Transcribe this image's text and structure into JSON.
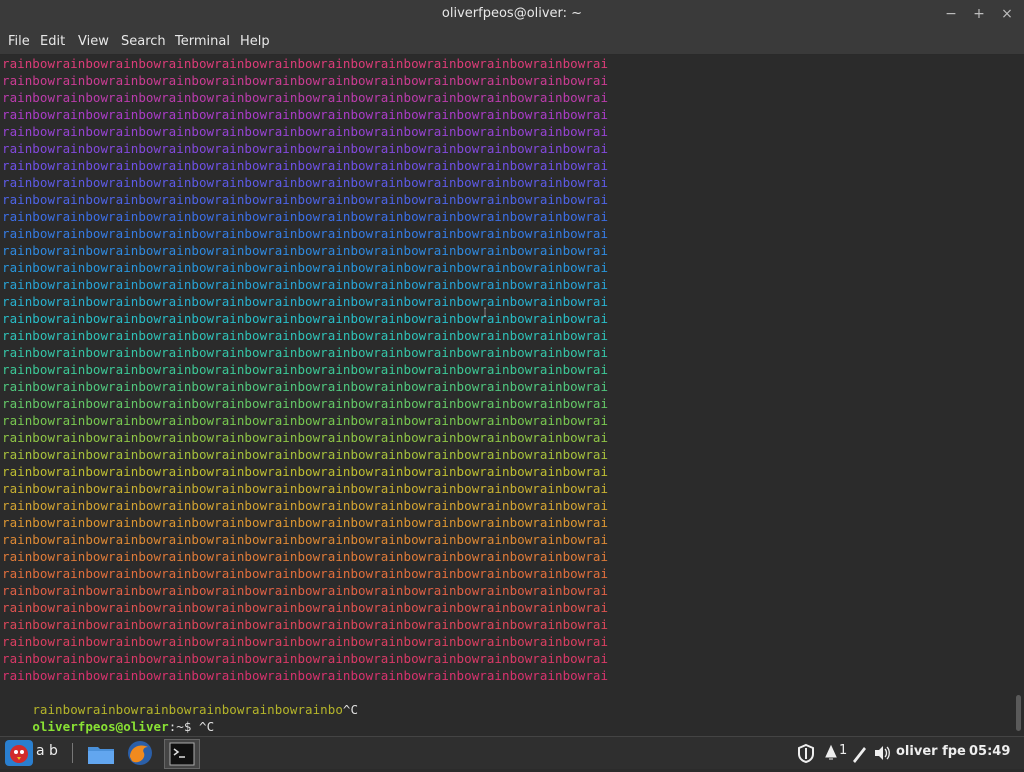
{
  "window": {
    "title": "oliverfpeos@oliver: ~",
    "minimize_glyph": "−",
    "maximize_glyph": "+",
    "close_glyph": "×"
  },
  "menu": [
    "File",
    "Edit",
    "View",
    "Search",
    "Terminal",
    "Help"
  ],
  "terminal": {
    "rainbow_line": "rainbowrainbowrainbowrainbowrainbowrainbowrainbowrainbowrainbowrainbowrainbowrai",
    "rainbow_line_count": 37,
    "partial_line": "rainbowrainbowrainbowrainbowrainbowrainbo",
    "interrupt": "^C",
    "prompt_user": "oliverfpeos@oliver",
    "prompt_path": ":~$",
    "command_1": " ^C",
    "command_2": " ",
    "colors": {
      "prompt_user": "#8ae234",
      "partial_line": "#b5b52a"
    }
  },
  "taskbar": {
    "app_label": "a b",
    "clock": "05:49",
    "user": "oliver fpe",
    "notifications_count": "1",
    "icons": [
      "menu-bird-icon",
      "files-icon",
      "firefox-icon",
      "terminal-icon",
      "shield-icon",
      "notification-icon",
      "pen-icon",
      "volume-icon"
    ]
  }
}
